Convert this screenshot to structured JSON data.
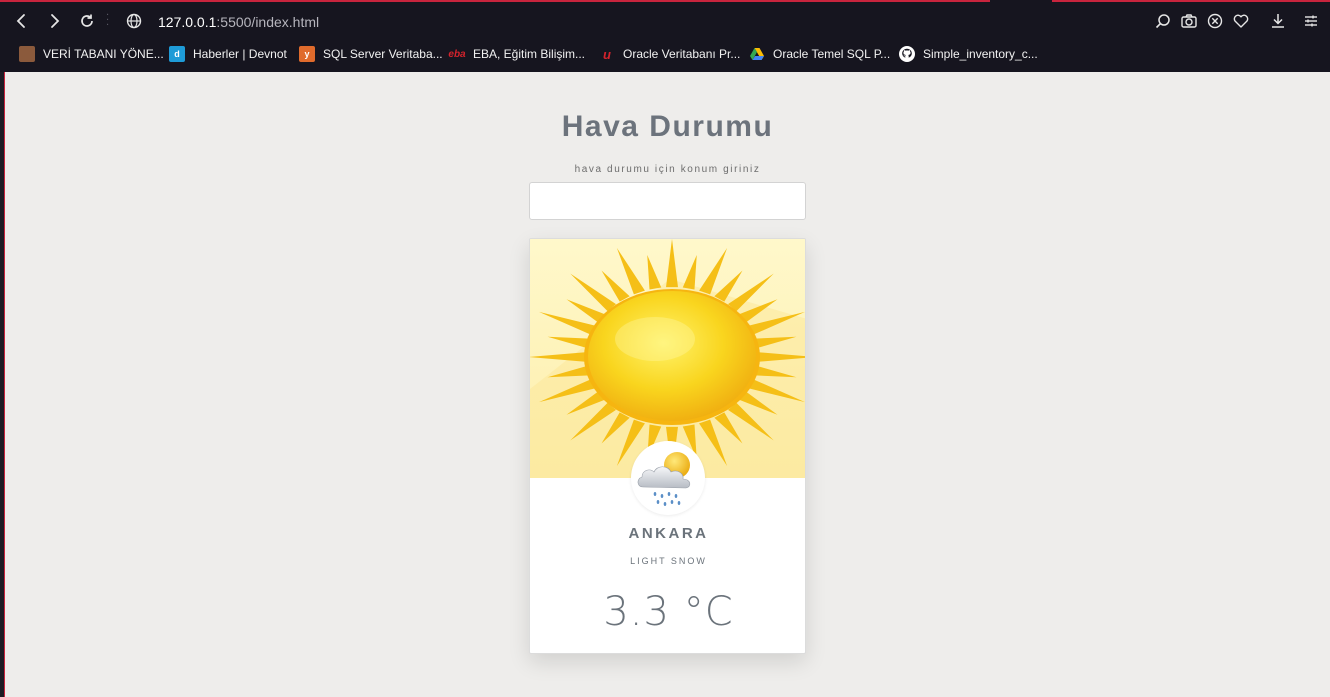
{
  "browser": {
    "url_host": "127.0.0.1",
    "url_path": ":5500/index.html",
    "bookmarks": [
      {
        "label": "VERİ TABANI YÖNE...",
        "icon": "database-book-icon",
        "color": "#8b5a3c"
      },
      {
        "label": "Haberler | Devnot",
        "icon": "devnot-icon",
        "color": "#1e9bd7"
      },
      {
        "label": "SQL Server Veritaba...",
        "icon": "sql-server-icon",
        "color": "#e06b2c"
      },
      {
        "label": "EBA, Eğitim Bilişim...",
        "icon": "eba-icon",
        "color": "#d4232c"
      },
      {
        "label": "Oracle Veritabanı Pr...",
        "icon": "udemy-icon",
        "color": "#d4232c"
      },
      {
        "label": "Oracle Temel SQL P...",
        "icon": "google-drive-icon",
        "color": "#34a853"
      },
      {
        "label": "Simple_inventory_c...",
        "icon": "github-icon",
        "color": "#ffffff"
      }
    ]
  },
  "app": {
    "title": "Hava Durumu",
    "hint": "hava durumu için konum giriniz",
    "search_value": "",
    "search_placeholder": ""
  },
  "weather": {
    "city": "ANKARA",
    "description": "LIGHT SNOW",
    "temperature": "3.3 °C",
    "condition_icon": "cloud-sun-rain-icon",
    "hero_image": "sun-illustration"
  },
  "colors": {
    "chrome_bg": "#16151f",
    "accent": "#c8243d",
    "page_bg": "#eeedeb",
    "text_muted": "#6b737b",
    "hero_bg": "#fdf3b9",
    "sun": "#f7cc1c"
  }
}
